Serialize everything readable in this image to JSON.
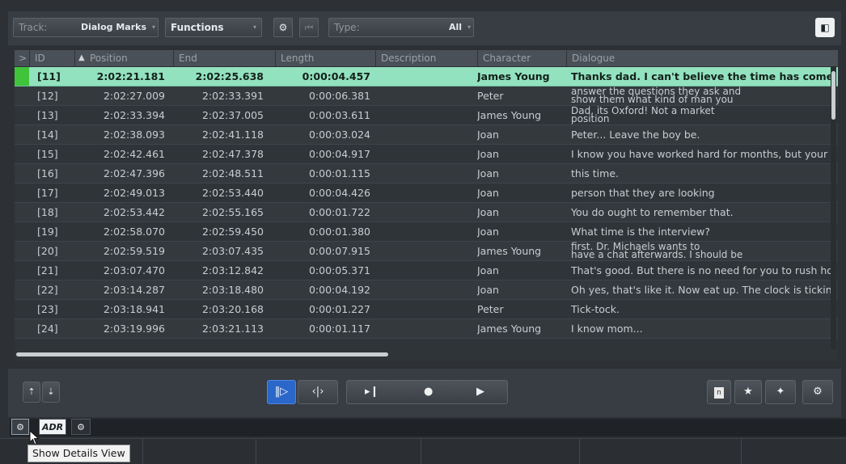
{
  "toolbar": {
    "track_label": "Track:",
    "track_value": "Dialog Marks",
    "functions_label": "Functions",
    "type_label": "Type:",
    "type_value": "All"
  },
  "table": {
    "columns": [
      "ID",
      "Position",
      "End",
      "Length",
      "Description",
      "Character",
      "Dialogue"
    ],
    "rows": [
      {
        "id": "[11]",
        "pos": "2:02:21.181",
        "end": "2:02:25.638",
        "len": "0:00:04.457",
        "char": "James Young",
        "dlg": "Thanks dad. I can't believe the time has come, alr",
        "selected": true
      },
      {
        "id": "[12]",
        "pos": "2:02:27.009",
        "end": "2:02:33.391",
        "len": "0:00:06.381",
        "char": "Peter",
        "dlg": "answer the questions they ask and",
        "dlg2": "show them what kind of man you"
      },
      {
        "id": "[13]",
        "pos": "2:02:33.394",
        "end": "2:02:37.005",
        "len": "0:00:03.611",
        "char": "James Young",
        "dlg": "Dad, its Oxford! Not a market",
        "dlg2": "position"
      },
      {
        "id": "[14]",
        "pos": "2:02:38.093",
        "end": "2:02:41.118",
        "len": "0:00:03.024",
        "char": "Joan",
        "dlg": "Peter... Leave the boy be."
      },
      {
        "id": "[15]",
        "pos": "2:02:42.461",
        "end": "2:02:47.378",
        "len": "0:00:04.917",
        "char": "Joan",
        "dlg": "I know you have worked hard for months, but your d"
      },
      {
        "id": "[16]",
        "pos": "2:02:47.396",
        "end": "2:02:48.511",
        "len": "0:00:01.115",
        "char": "Joan",
        "dlg": "this time."
      },
      {
        "id": "[17]",
        "pos": "2:02:49.013",
        "end": "2:02:53.440",
        "len": "0:00:04.426",
        "char": "Joan",
        "dlg": "person that they are looking"
      },
      {
        "id": "[18]",
        "pos": "2:02:53.442",
        "end": "2:02:55.165",
        "len": "0:00:01.722",
        "char": "Joan",
        "dlg": "You do ought to remember that."
      },
      {
        "id": "[19]",
        "pos": "2:02:58.070",
        "end": "2:02:59.450",
        "len": "0:00:01.380",
        "char": "Joan",
        "dlg": "What time is the interview?"
      },
      {
        "id": "[20]",
        "pos": "2:02:59.519",
        "end": "2:03:07.435",
        "len": "0:00:07.915",
        "char": "James Young",
        "dlg": "first. Dr. Michaels wants to",
        "dlg2": "have a chat afterwards. I should be"
      },
      {
        "id": "[21]",
        "pos": "2:03:07.470",
        "end": "2:03:12.842",
        "len": "0:00:05.371",
        "char": "Joan",
        "dlg": "That's good. But there is no need for you to rush hor"
      },
      {
        "id": "[22]",
        "pos": "2:03:14.287",
        "end": "2:03:18.480",
        "len": "0:00:04.192",
        "char": "Joan",
        "dlg": "Oh yes, that's like it. Now eat up. The clock is ticking."
      },
      {
        "id": "[23]",
        "pos": "2:03:18.941",
        "end": "2:03:20.168",
        "len": "0:00:01.227",
        "char": "Peter",
        "dlg": "Tick-tock."
      },
      {
        "id": "[24]",
        "pos": "2:03:19.996",
        "end": "2:03:21.113",
        "len": "0:00:01.117",
        "char": "James Young",
        "dlg": "I know mom..."
      }
    ]
  },
  "tabs": {
    "adr_label": "ADR"
  },
  "tooltip": "Show Details View",
  "colors": {
    "selected_row": "#93e2bf",
    "selected_marker": "#3fc43a",
    "accent_blue": "#2a67c8"
  }
}
